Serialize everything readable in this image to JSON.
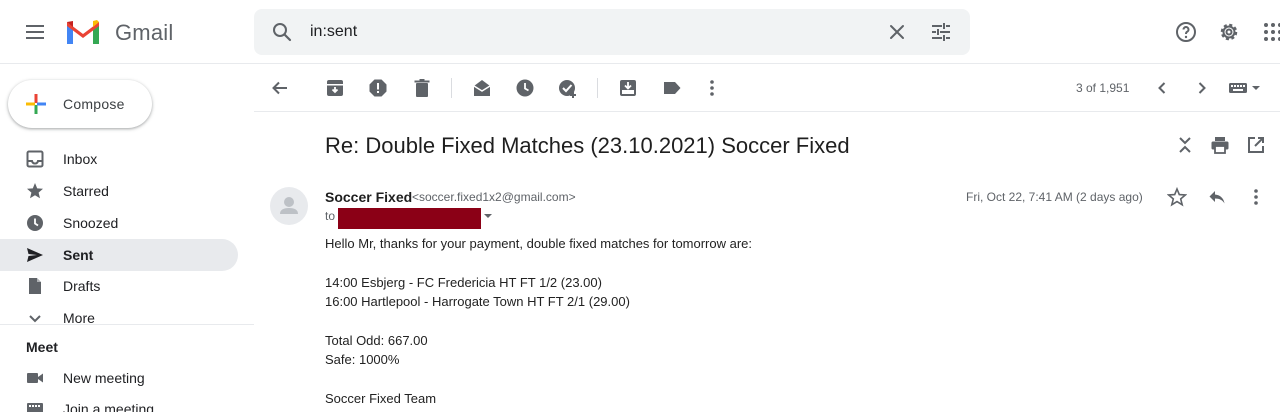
{
  "header": {
    "brand": "Gmail",
    "search_value": "in:sent"
  },
  "sidebar": {
    "compose_label": "Compose",
    "items": [
      {
        "label": "Inbox",
        "icon": "inbox-icon"
      },
      {
        "label": "Starred",
        "icon": "star-icon"
      },
      {
        "label": "Snoozed",
        "icon": "clock-icon"
      },
      {
        "label": "Sent",
        "icon": "send-icon",
        "active": true
      },
      {
        "label": "Drafts",
        "icon": "draft-icon"
      },
      {
        "label": "More",
        "icon": "chevron-down-icon"
      }
    ],
    "meet": {
      "title": "Meet",
      "items": [
        {
          "label": "New meeting",
          "icon": "video-icon"
        },
        {
          "label": "Join a meeting",
          "icon": "keyboard-icon"
        }
      ]
    }
  },
  "toolbar": {
    "pager": "3 of 1,951"
  },
  "message": {
    "subject": "Re: Double Fixed Matches (23.10.2021) Soccer Fixed",
    "sender_name": "Soccer Fixed",
    "sender_email": "<soccer.fixed1x2@gmail.com>",
    "to_label": "to",
    "date": "Fri, Oct 22, 7:41 AM (2 days ago)",
    "body": [
      "Hello Mr, thanks for your payment, double fixed matches for tomorrow are:",
      "14:00 Esbjerg - FC Fredericia HT FT 1/2 (23.00)",
      "16:00 Hartlepool - Harrogate Town HT FT 2/1 (29.00)",
      "Total Odd: 667.00",
      "Safe: 1000%",
      "Soccer Fixed Team"
    ]
  },
  "colors": {
    "accent_red": "#ea4335",
    "accent_blue": "#4285f4",
    "accent_green": "#34a853",
    "accent_yellow": "#fbbc04",
    "redaction": "#8b0016",
    "active_nav_bg": "#e8eaed"
  }
}
